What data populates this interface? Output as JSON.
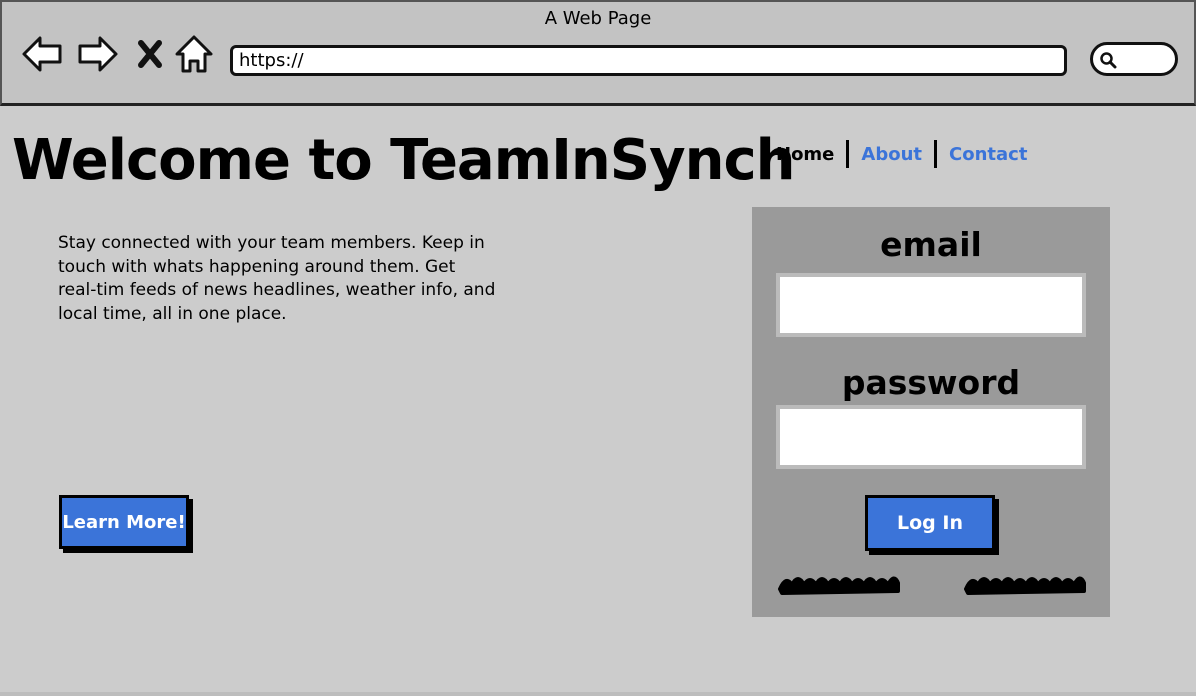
{
  "window": {
    "title": "A Web Page"
  },
  "toolbar": {
    "icons": [
      "back-arrow-icon",
      "forward-arrow-icon",
      "stop-icon",
      "home-icon",
      "search-icon"
    ],
    "url": "https://"
  },
  "page": {
    "title": "Welcome to TeamInSynch",
    "nav": {
      "home": "Home",
      "about": "About",
      "contact": "Contact"
    },
    "intro": "Stay connected with your team members. Keep in touch with whats happening around them. Get real-tim feeds of news headlines, weather info, and local time, all in one place.",
    "learn_more": "Learn More!"
  },
  "login": {
    "email_label": "email",
    "password_label": "password",
    "button": "Log In"
  },
  "colors": {
    "accent": "#3b74d9",
    "background": "#cccccc",
    "panel": "#9a9a9a",
    "chrome": "#c3c3c3"
  }
}
